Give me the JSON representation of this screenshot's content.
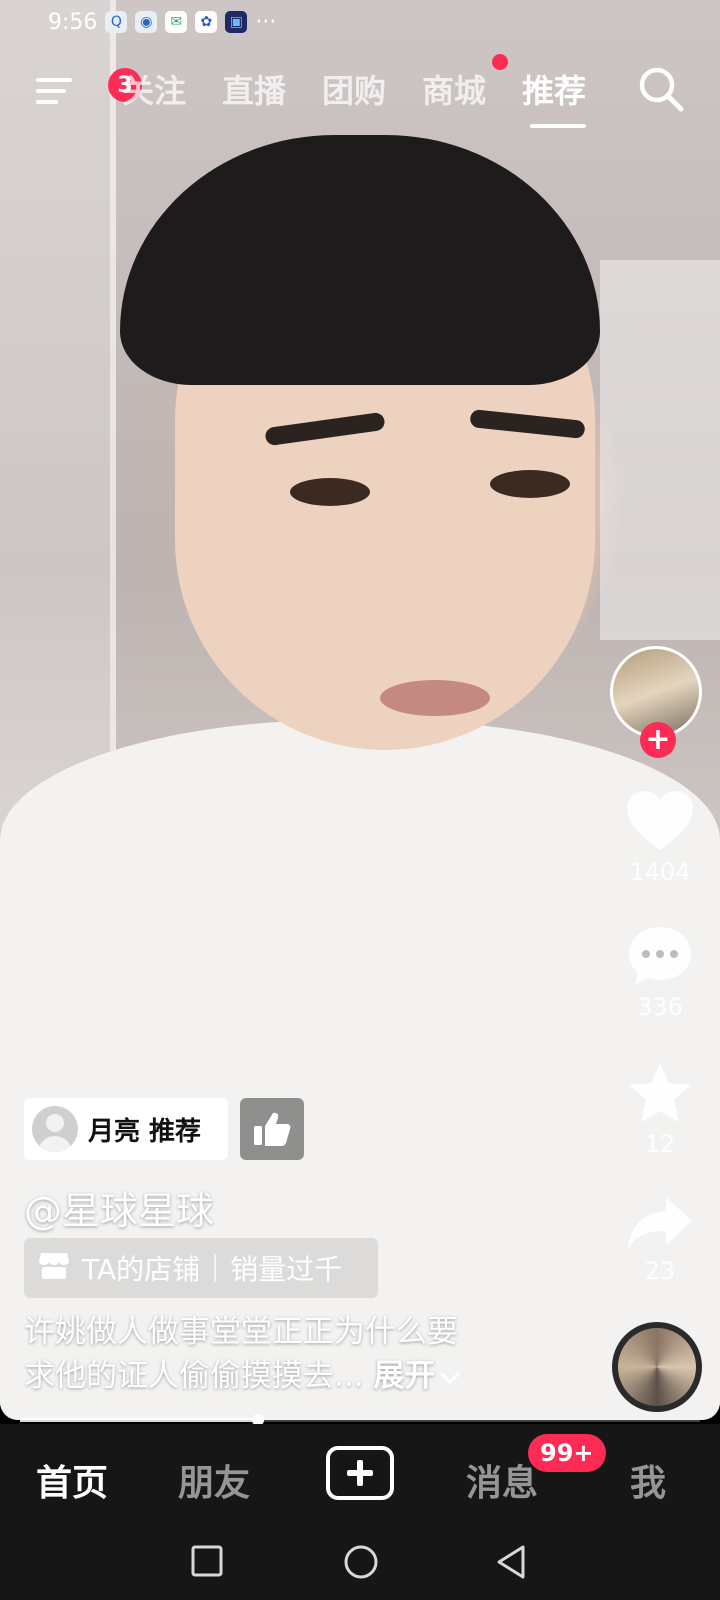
{
  "status_bar": {
    "time": "9:56",
    "more": "···",
    "icons": [
      "qq-icon",
      "browser-icon",
      "wechat-icon",
      "baidu-icon",
      "app-icon"
    ]
  },
  "top_nav": {
    "menu_badge": "3",
    "tabs": [
      {
        "label": "关注"
      },
      {
        "label": "直播"
      },
      {
        "label": "团购"
      },
      {
        "label": "商城"
      },
      {
        "label": "推荐"
      }
    ],
    "active_tab": "推荐"
  },
  "side_actions": {
    "like_count": "1404",
    "comment_count": "336",
    "favorite_count": "12",
    "share_count": "23"
  },
  "video_info": {
    "recommender": "月亮 推荐",
    "author": "@星球星球",
    "shop_label": "TA的店铺",
    "sales_label": "销量过千",
    "description_line1": "许姚做人做事堂堂正正为什么要",
    "description_line2": "求他的证人偷偷摸摸去...",
    "expand_label": "展开"
  },
  "progress": {
    "played_fraction": 0.35
  },
  "bottom_tabs": {
    "home": "首页",
    "friends": "朋友",
    "messages": "消息",
    "messages_badge": "99+",
    "me": "我"
  },
  "colors": {
    "accent": "#fe2c55",
    "tabbar_bg": "#161616"
  }
}
